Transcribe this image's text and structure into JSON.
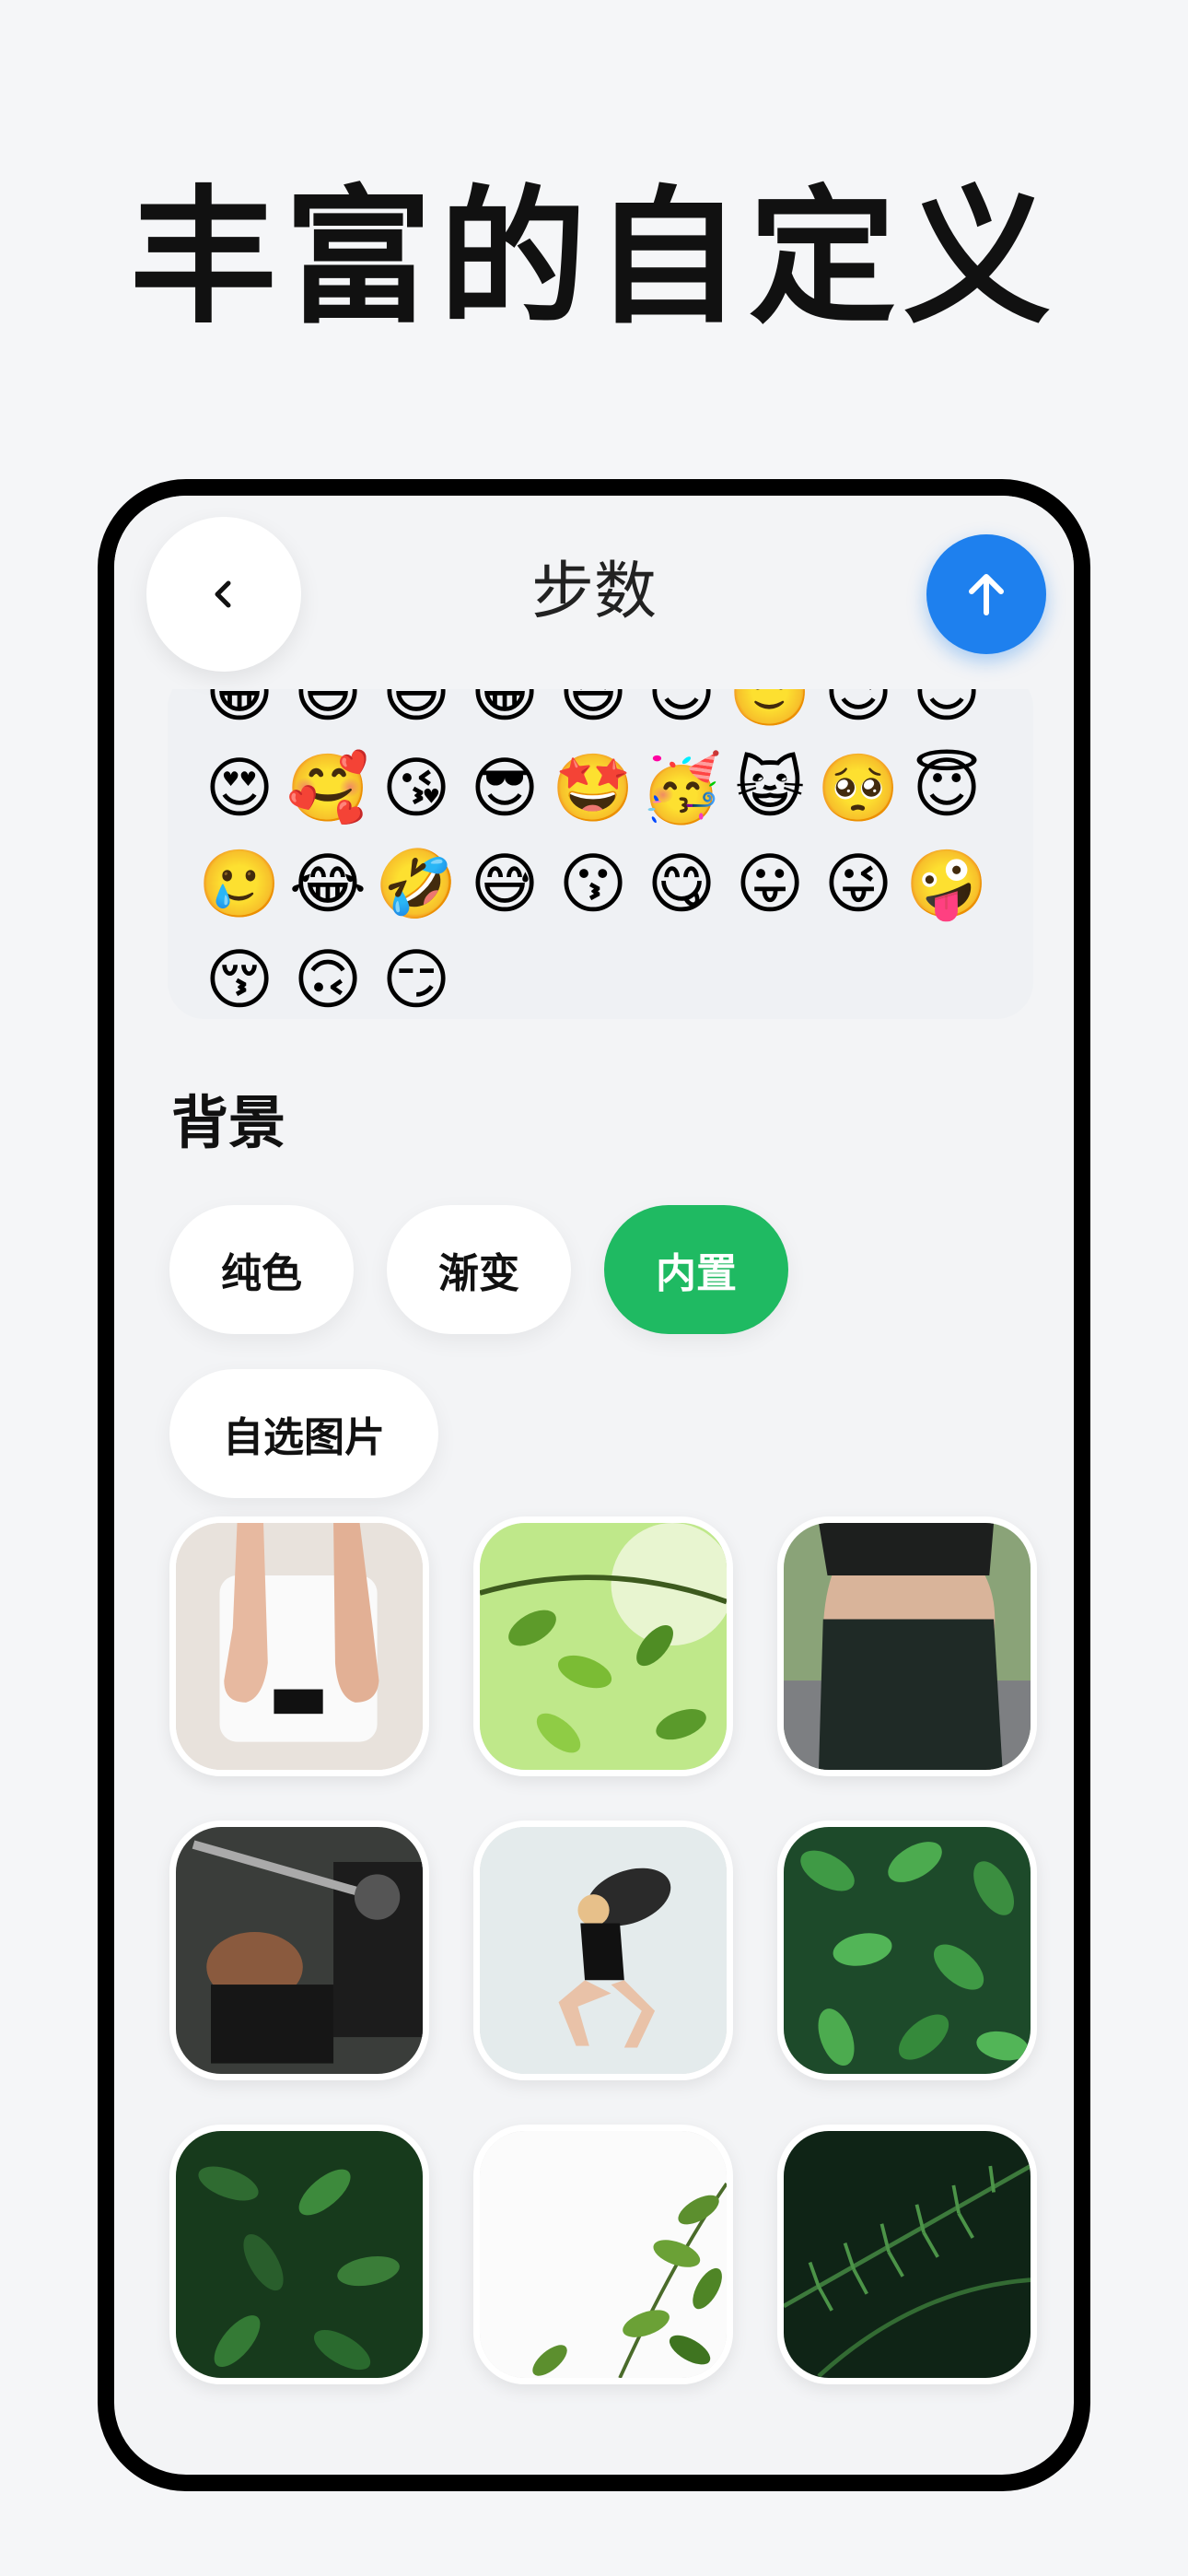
{
  "headline": "丰富的自定义",
  "header": {
    "title": "步数"
  },
  "emoji_rows": [
    [
      "😍",
      "🥰",
      "😘",
      "😎",
      "🤩",
      "🥳",
      "😺",
      "🥺",
      "😇"
    ],
    [
      "🥲",
      "😂",
      "🤣",
      "😅",
      "😗",
      "😋",
      "😛",
      "😜",
      "🤪"
    ],
    [
      "😚",
      "🙃",
      "😏"
    ]
  ],
  "background_section": {
    "title": "背景",
    "options": [
      "纯色",
      "渐变",
      "内置",
      "自选图片"
    ],
    "selected": "内置"
  },
  "tiles": [
    "scale-feet",
    "green-leaves-branch",
    "black-sportswear",
    "bench-press",
    "sandbag-squat",
    "leaf-pattern",
    "dense-leaves",
    "white-plant",
    "fern"
  ],
  "colors": {
    "accent": "#1fba62",
    "primary": "#1e80ee"
  }
}
